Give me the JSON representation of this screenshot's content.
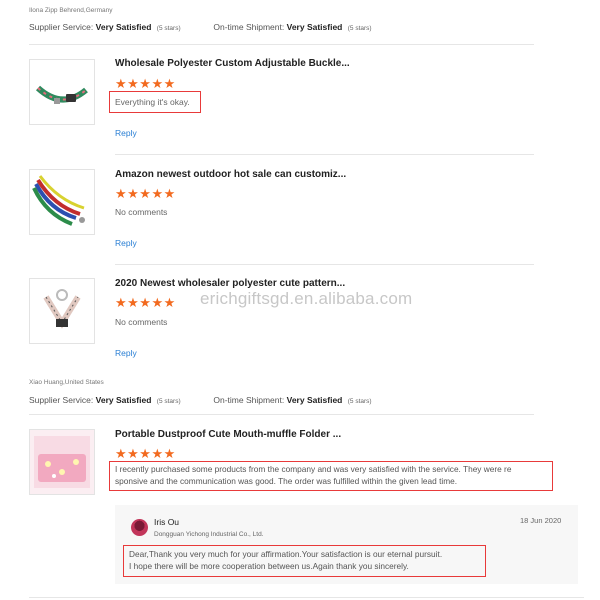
{
  "labels": {
    "supplier_service": "Supplier Service:",
    "ontime_shipment": "On-time Shipment:",
    "reply": "Reply"
  },
  "watermark": "erichgiftsgd.en.alibaba.com",
  "review_groups": [
    {
      "reviewer": "Ilona Zipp Behrend,Germany",
      "supplier_service": "Very Satisfied",
      "supplier_stars": "(5 stars)",
      "ontime_shipment": "Very Satisfied",
      "shipment_stars": "(5 stars)",
      "items": [
        {
          "thumb_icon": "dog-collar-icon",
          "title": "Wholesale Polyester Custom Adjustable Buckle...",
          "stars": "★★★★★",
          "comment": "Everything it's okay."
        },
        {
          "thumb_icon": "dog-leash-icon",
          "title": "Amazon newest outdoor hot sale can customiz...",
          "stars": "★★★★★",
          "comment": "No comments"
        },
        {
          "thumb_icon": "dog-harness-icon",
          "title": "2020 Newest wholesaler polyester cute pattern...",
          "stars": "★★★★★",
          "comment": "No comments"
        }
      ]
    },
    {
      "reviewer": "Xiao Huang,United States",
      "supplier_service": "Very Satisfied",
      "supplier_stars": "(5 stars)",
      "ontime_shipment": "Very Satisfied",
      "shipment_stars": "(5 stars)",
      "items": [
        {
          "thumb_icon": "mask-folder-icon",
          "title": "Portable Dustproof Cute Mouth-muffle Folder ...",
          "stars": "★★★★★",
          "comment_line1": "I recently purchased some products from the company and was very satisfied with the service. They were re",
          "comment_line2": "sponsive and the communication was good. The order was fulfilled within the given lead time."
        }
      ]
    }
  ],
  "supplier_reply": {
    "name": "Iris Ou",
    "company": "Dongguan Yichong Industrial Co., Ltd.",
    "date": "18 Jun 2020",
    "line1": "Dear,Thank you very much for your affirmation.Your satisfaction is our eternal pursuit.",
    "line2": "I hope there will be more cooperation between us.Again thank you sincerely."
  },
  "colors": {
    "star": "#f26a1f",
    "link": "#2a7fd4",
    "highlight_box": "#e83a3a"
  }
}
